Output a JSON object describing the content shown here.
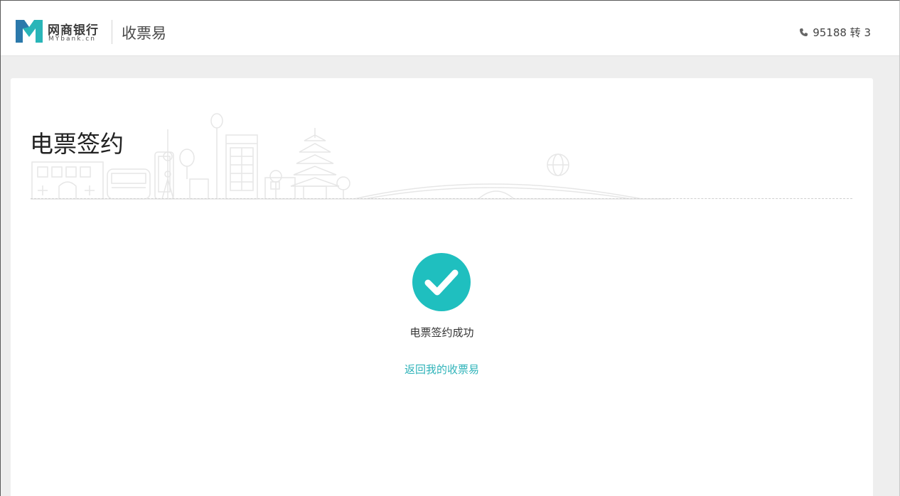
{
  "header": {
    "brand_cn": "网商银行",
    "brand_en": "MYbank.cn",
    "product": "收票易",
    "phone": "95188 转 3"
  },
  "main": {
    "title": "电票签约",
    "status_text": "电票签约成功",
    "back_link": "返回我的收票易"
  },
  "icons": {
    "logo": "mybank-logo-icon",
    "phone": "phone-icon",
    "success": "check-circle-icon",
    "banner": "city-skyline-illustration"
  },
  "colors": {
    "accent": "#2fb3b9",
    "success_circle": "#1fbfbf",
    "logo_teal": "#29b5b8",
    "logo_blue": "#2b6fa8"
  }
}
